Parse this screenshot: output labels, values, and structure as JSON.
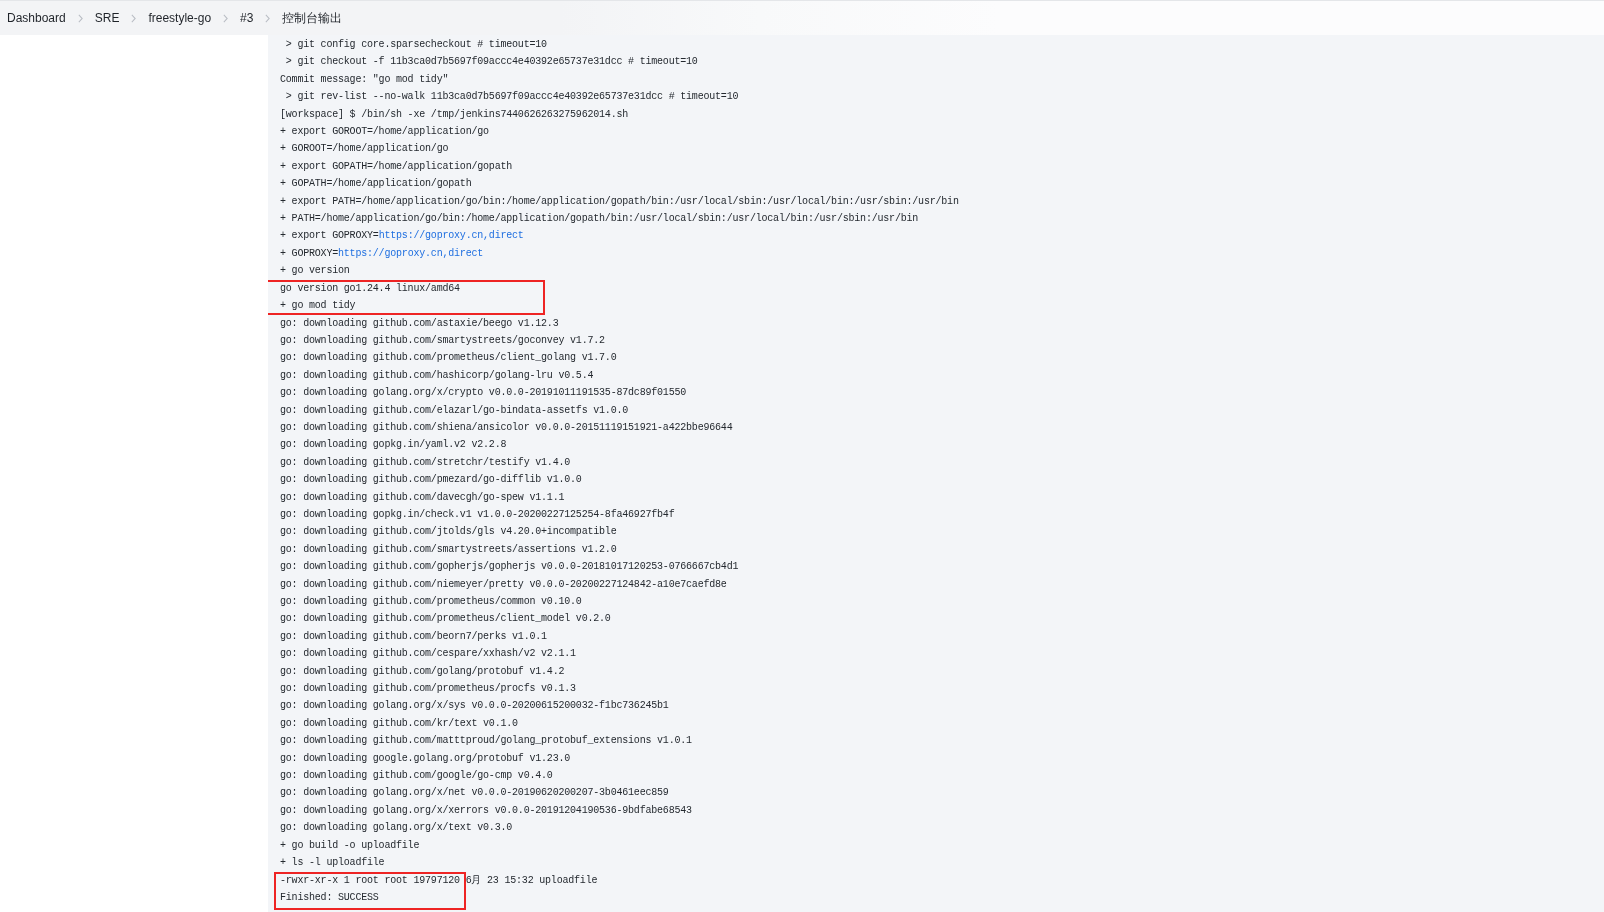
{
  "breadcrumb": [
    "Dashboard",
    "SRE",
    "freestyle-go",
    "#3",
    "控制台输出"
  ],
  "console": {
    "lines": [
      {
        "text": " > git config core.sparsecheckout # timeout=10",
        "highlighted": false
      },
      {
        "text": " > git checkout -f 11b3ca0d7b5697f09accc4e40392e65737e31dcc # timeout=10",
        "highlighted": false
      },
      {
        "text": "Commit message: \"go mod tidy\"",
        "highlighted": false
      },
      {
        "text": " > git rev-list --no-walk 11b3ca0d7b5697f09accc4e40392e65737e31dcc # timeout=10",
        "highlighted": false
      },
      {
        "text": "[workspace] $ /bin/sh -xe /tmp/jenkins7440626263275962014.sh",
        "highlighted": false
      },
      {
        "text": "+ export GOROOT=/home/application/go",
        "highlighted": false
      },
      {
        "text": "+ GOROOT=/home/application/go",
        "highlighted": false
      },
      {
        "text": "+ export GOPATH=/home/application/gopath",
        "highlighted": false
      },
      {
        "text": "+ GOPATH=/home/application/gopath",
        "highlighted": false
      },
      {
        "text": "+ export PATH=/home/application/go/bin:/home/application/gopath/bin:/usr/local/sbin:/usr/local/bin:/usr/sbin:/usr/bin",
        "highlighted": false
      },
      {
        "text": "+ PATH=/home/application/go/bin:/home/application/gopath/bin:/usr/local/sbin:/usr/local/bin:/usr/sbin:/usr/bin",
        "highlighted": false
      },
      {
        "text": "+ export GOPROXY=",
        "link": "https://goproxy.cn,direct",
        "highlighted": false
      },
      {
        "text": "+ GOPROXY=",
        "link": "https://goproxy.cn,direct",
        "highlighted": false
      },
      {
        "text": "+ go version",
        "highlighted": false
      },
      {
        "text": "go version go1.24.4 linux/amd64",
        "highlighted": true
      },
      {
        "text": "+ go mod tidy",
        "highlighted": true
      },
      {
        "text": "go: downloading github.com/astaxie/beego v1.12.3",
        "highlighted": false
      },
      {
        "text": "go: downloading github.com/smartystreets/goconvey v1.7.2",
        "highlighted": false
      },
      {
        "text": "go: downloading github.com/prometheus/client_golang v1.7.0",
        "highlighted": false
      },
      {
        "text": "go: downloading github.com/hashicorp/golang-lru v0.5.4",
        "highlighted": false
      },
      {
        "text": "go: downloading golang.org/x/crypto v0.0.0-20191011191535-87dc89f01550",
        "highlighted": false
      },
      {
        "text": "go: downloading github.com/elazarl/go-bindata-assetfs v1.0.0",
        "highlighted": false
      },
      {
        "text": "go: downloading github.com/shiena/ansicolor v0.0.0-20151119151921-a422bbe96644",
        "highlighted": false
      },
      {
        "text": "go: downloading gopkg.in/yaml.v2 v2.2.8",
        "highlighted": false
      },
      {
        "text": "go: downloading github.com/stretchr/testify v1.4.0",
        "highlighted": false
      },
      {
        "text": "go: downloading github.com/pmezard/go-difflib v1.0.0",
        "highlighted": false
      },
      {
        "text": "go: downloading github.com/davecgh/go-spew v1.1.1",
        "highlighted": false
      },
      {
        "text": "go: downloading gopkg.in/check.v1 v1.0.0-20200227125254-8fa46927fb4f",
        "highlighted": false
      },
      {
        "text": "go: downloading github.com/jtolds/gls v4.20.0+incompatible",
        "highlighted": false
      },
      {
        "text": "go: downloading github.com/smartystreets/assertions v1.2.0",
        "highlighted": false
      },
      {
        "text": "go: downloading github.com/gopherjs/gopherjs v0.0.0-20181017120253-0766667cb4d1",
        "highlighted": false
      },
      {
        "text": "go: downloading github.com/niemeyer/pretty v0.0.0-20200227124842-a10e7caefd8e",
        "highlighted": false
      },
      {
        "text": "go: downloading github.com/prometheus/common v0.10.0",
        "highlighted": false
      },
      {
        "text": "go: downloading github.com/prometheus/client_model v0.2.0",
        "highlighted": false
      },
      {
        "text": "go: downloading github.com/beorn7/perks v1.0.1",
        "highlighted": false
      },
      {
        "text": "go: downloading github.com/cespare/xxhash/v2 v2.1.1",
        "highlighted": false
      },
      {
        "text": "go: downloading github.com/golang/protobuf v1.4.2",
        "highlighted": false
      },
      {
        "text": "go: downloading github.com/prometheus/procfs v0.1.3",
        "highlighted": false
      },
      {
        "text": "go: downloading golang.org/x/sys v0.0.0-20200615200032-f1bc736245b1",
        "highlighted": false
      },
      {
        "text": "go: downloading github.com/kr/text v0.1.0",
        "highlighted": false
      },
      {
        "text": "go: downloading github.com/matttproud/golang_protobuf_extensions v1.0.1",
        "highlighted": false
      },
      {
        "text": "go: downloading google.golang.org/protobuf v1.23.0",
        "highlighted": false
      },
      {
        "text": "go: downloading github.com/google/go-cmp v0.4.0",
        "highlighted": false
      },
      {
        "text": "go: downloading golang.org/x/net v0.0.0-20190620200207-3b0461eec859",
        "highlighted": false
      },
      {
        "text": "go: downloading golang.org/x/xerrors v0.0.0-20191204190536-9bdfabe68543",
        "highlighted": false
      },
      {
        "text": "go: downloading golang.org/x/text v0.3.0",
        "highlighted": false
      },
      {
        "text": "+ go build -o uploadfile",
        "highlighted": false
      },
      {
        "text": "+ ls -l uploadfile",
        "highlighted": false
      },
      {
        "text": "-rwxr-xr-x 1 root root 19797120 6月 23 15:32 uploadfile",
        "highlighted": true
      },
      {
        "text": "Finished: SUCCESS",
        "highlighted": true
      }
    ]
  }
}
